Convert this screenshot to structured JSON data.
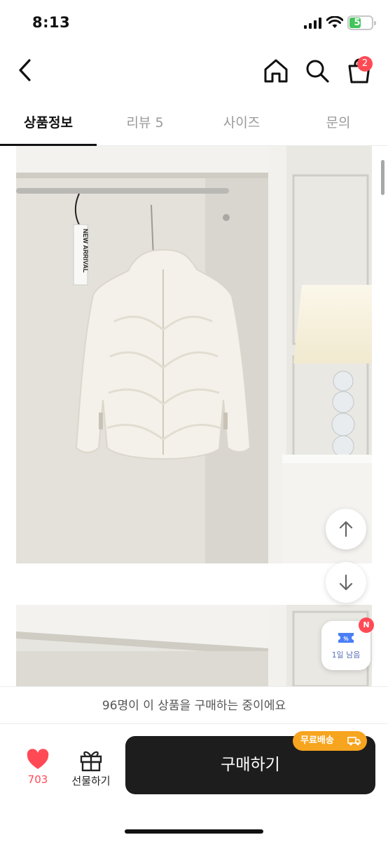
{
  "status_bar": {
    "time": "8:13",
    "battery": "52"
  },
  "header": {
    "cart_count": "2"
  },
  "tabs": [
    {
      "label": "상품정보"
    },
    {
      "label": "리뷰 5"
    },
    {
      "label": "사이즈"
    },
    {
      "label": "문의"
    }
  ],
  "product_image": {
    "tag_text": "NEW ARRIVAL"
  },
  "coupon": {
    "label": "1일 남음",
    "badge": "N"
  },
  "notice": {
    "text": "96명이 이 상품을 구매하는 중이에요"
  },
  "bottom_bar": {
    "like_count": "703",
    "gift_label": "선물하기",
    "buy_label": "구매하기",
    "free_shipping": "무료배송"
  },
  "colors": {
    "accent": "#ff4a55",
    "buy_button": "#1d1d1d",
    "free_shipping": "#f7a41e"
  }
}
